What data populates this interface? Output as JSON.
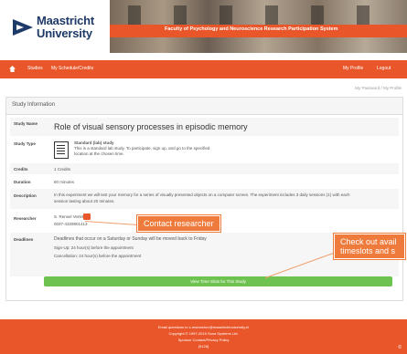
{
  "header": {
    "logo_line1": "Maastricht",
    "logo_line2": "University",
    "banner_text": "Faculty of Psychology and Neuroscience Research Participation System"
  },
  "nav": {
    "home": "Studies",
    "my_schedule": "My Schedule/Credits",
    "my_profile": "My Profile",
    "logout": "Logout"
  },
  "subnav": "My Password / My Profile",
  "panel_title": "Study Information",
  "study": {
    "name_label": "Study Name",
    "name": "Role of visual sensory processes in episodic memory",
    "type_label": "Study Type",
    "type_title": "Standard (lab) study",
    "type_desc_1": "This is a standard lab study. To participate, sign up, and go to the specified",
    "type_desc_2": "location at the chosen time.",
    "credits_label": "Credits",
    "credits": "1 Credits",
    "duration_label": "Duration",
    "duration": "60 minutes",
    "description_label": "Description",
    "description_1": "In this experiment we will test your memory for a series of visually presented objects on a computer screen. The experiment includes 3 daily sessions (1) with each",
    "description_2": "session lasting about 20 minutes.",
    "researcher_label": "Researcher",
    "researcher_name": "S. Rensel Verlet",
    "researcher_email": "0037-4329801413",
    "deadlines_label": "Deadlines",
    "deadline_1": "Deadlines that occur on a Saturday or Sunday will be moved back to Friday",
    "deadline_2": "Sign-Up: 24 hour(s) before the appointment",
    "deadline_3": "Cancellation: 24 hour(s) before the appointment"
  },
  "timeslots_button": "View Time Slots for This Study",
  "callouts": {
    "contact": "Contact researcher",
    "timeslots_line1": "Check out avail",
    "timeslots_line2": "timeslots and s"
  },
  "footer": {
    "line1": "Email questions to s.researcher@maastrichtuniversity.nl",
    "line2": "Copyright © 1997-2015 Sona Systems Ltd.",
    "line3": "Sponsor Contact/Privacy Policy",
    "line4": "[9126]",
    "corner": "©"
  },
  "colors": {
    "accent": "#e8562a",
    "callout": "#ee7a3c",
    "button": "#6ec24f",
    "brand_blue": "#1e3a68"
  },
  "icons": {
    "logo": "maastricht-logo-icon",
    "home": "home-icon",
    "study_type": "document-icon",
    "contact": "envelope-icon",
    "timeslot": "calendar-icon"
  }
}
